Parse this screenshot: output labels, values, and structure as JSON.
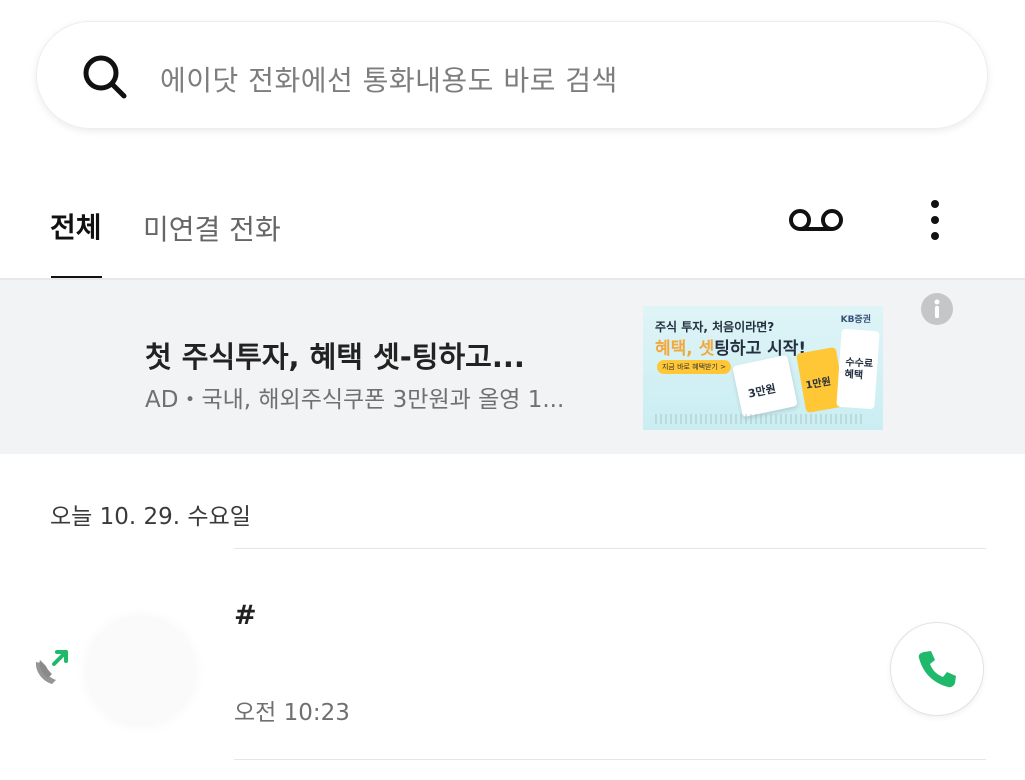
{
  "search": {
    "placeholder": "에이닷 전화에선 통화내용도 바로 검색",
    "icon": "search-icon"
  },
  "tabs": [
    {
      "label": "전체",
      "active": true
    },
    {
      "label": "미연결 전화",
      "active": false
    }
  ],
  "toolbar": {
    "voicemail_icon": "voicemail-icon",
    "more_icon": "more-vertical-icon"
  },
  "ad": {
    "title": "첫 주식투자, 혜택 셋-팅하고...",
    "description": "AD・국내, 해외주식쿠폰 3만원과 올영 1...",
    "banner": {
      "brand": "KB증권",
      "line1": "주식 투자, 처음이라면?",
      "line2_highlight": "혜택, 셋",
      "line2_rest": "팅하고 시작!",
      "button": "지금 바로 혜택받기 >",
      "card1": "3만원",
      "card2": "1만원",
      "card3": "수수료 혜택"
    },
    "info_icon": "info-icon"
  },
  "date_header": "오늘 10. 29. 수요일",
  "calls": [
    {
      "number": "#",
      "time": "오전 10:23",
      "type_icon": "outgoing-call-icon",
      "action_icon": "phone-icon"
    }
  ],
  "colors": {
    "accent_green": "#1fb96b",
    "ad_background": "#f2f3f4",
    "banner_yellow": "#ffc636"
  }
}
